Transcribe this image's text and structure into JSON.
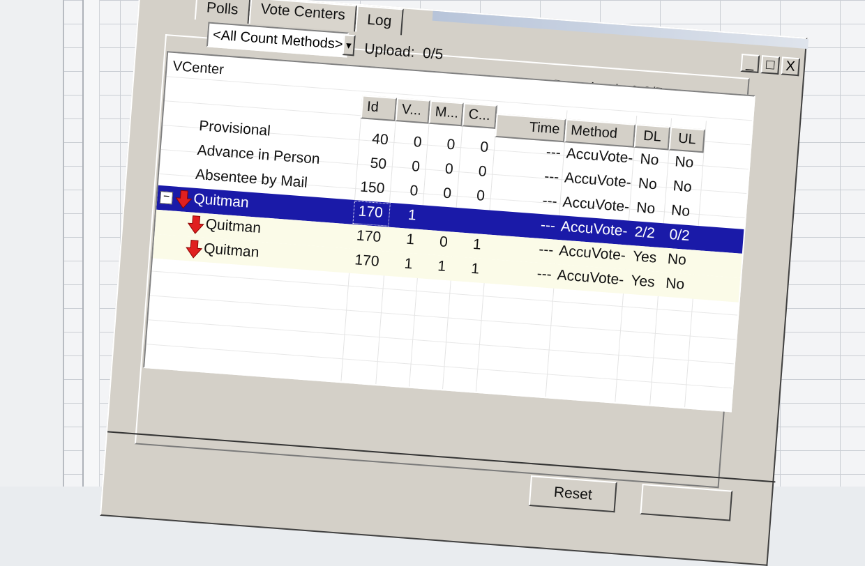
{
  "tabs": [
    {
      "label": "Polls"
    },
    {
      "label": "Vote Centers"
    },
    {
      "label": "Log"
    }
  ],
  "window_buttons": {
    "minimize": "_",
    "maximize": "□",
    "close": "X"
  },
  "filter": {
    "selected": "<All Count Methods>"
  },
  "upload": {
    "label": "Upload:",
    "value": "0/5"
  },
  "download": {
    "label": "Download:",
    "value": "0 2/5"
  },
  "tree": {
    "title": "VCenter",
    "columns": {
      "id": "Id",
      "v": "V...",
      "m": "M...",
      "c": "C...",
      "time": "Time",
      "method": "Method",
      "dl": "DL",
      "ul": "UL"
    },
    "rows": [
      {
        "name": "Provisional",
        "id": "40",
        "v": "0",
        "m": "0",
        "c": "0",
        "time": "---",
        "method": "AccuVote-",
        "dl": "No",
        "ul": "No"
      },
      {
        "name": "Advance in Person",
        "id": "50",
        "v": "0",
        "m": "0",
        "c": "0",
        "time": "---",
        "method": "AccuVote-",
        "dl": "No",
        "ul": "No"
      },
      {
        "name": "Absentee by Mail",
        "id": "150",
        "v": "0",
        "m": "0",
        "c": "0",
        "time": "---",
        "method": "AccuVote-",
        "dl": "No",
        "ul": "No"
      },
      {
        "name": "Quitman",
        "id": "170",
        "v": "1",
        "m": "",
        "c": "",
        "time": "---",
        "method": "AccuVote-",
        "dl": "2/2",
        "ul": "0/2",
        "expander": "−"
      },
      {
        "name": "Quitman",
        "id": "170",
        "v": "1",
        "m": "0",
        "c": "1",
        "time": "---",
        "method": "AccuVote-",
        "dl": "Yes",
        "ul": "No"
      },
      {
        "name": "Quitman",
        "id": "170",
        "v": "1",
        "m": "1",
        "c": "1",
        "time": "---",
        "method": "AccuVote-",
        "dl": "Yes",
        "ul": "No"
      }
    ]
  },
  "buttons": {
    "reset": "Reset"
  },
  "colors": {
    "selection": "#1a1aa8",
    "arrow": "#e02020",
    "row_highlight": "#fbfbe8"
  },
  "icons": [
    "download-arrow-icon",
    "collapse-icon",
    "minimize-icon",
    "maximize-icon",
    "close-icon"
  ]
}
